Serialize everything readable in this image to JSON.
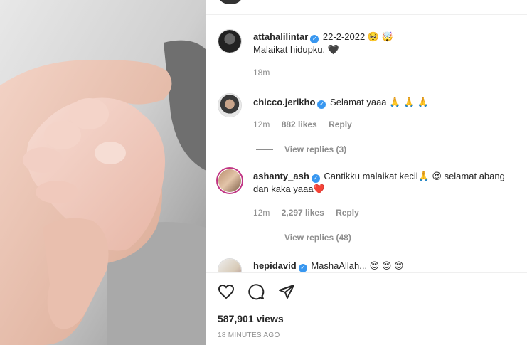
{
  "post": {
    "image_alt": "Baby hand holding adult finger",
    "caption": {
      "username": "attahalilintar",
      "text": "22-2-2022 🥺 🤯",
      "line2": "Malaikat hidupku. 🖤",
      "time": "18m"
    },
    "comments": [
      {
        "username": "chicco.jerikho",
        "text": "Selamat yaaa 🙏 🙏 🙏",
        "time": "12m",
        "likes": "882 likes",
        "reply_label": "Reply",
        "view_replies": "View replies (3)"
      },
      {
        "username": "ashanty_ash",
        "text": "Cantikku malaikat kecil🙏 😍 selamat abang dan kaka yaaa❤️",
        "time": "12m",
        "likes": "2,297 likes",
        "reply_label": "Reply",
        "view_replies": "View replies (48)"
      },
      {
        "username": "hepidavid",
        "text": "MashaAllah... 😍 😍 😍"
      }
    ],
    "views": "587,901 views",
    "posted": "18 MINUTES AGO"
  },
  "icons": {
    "like": "heart-icon",
    "comment": "comment-icon",
    "share": "share-icon",
    "verified": "verified-badge-icon"
  },
  "colors": {
    "verified": "#3897f0",
    "muted": "#8e8e8e",
    "text": "#262626"
  }
}
